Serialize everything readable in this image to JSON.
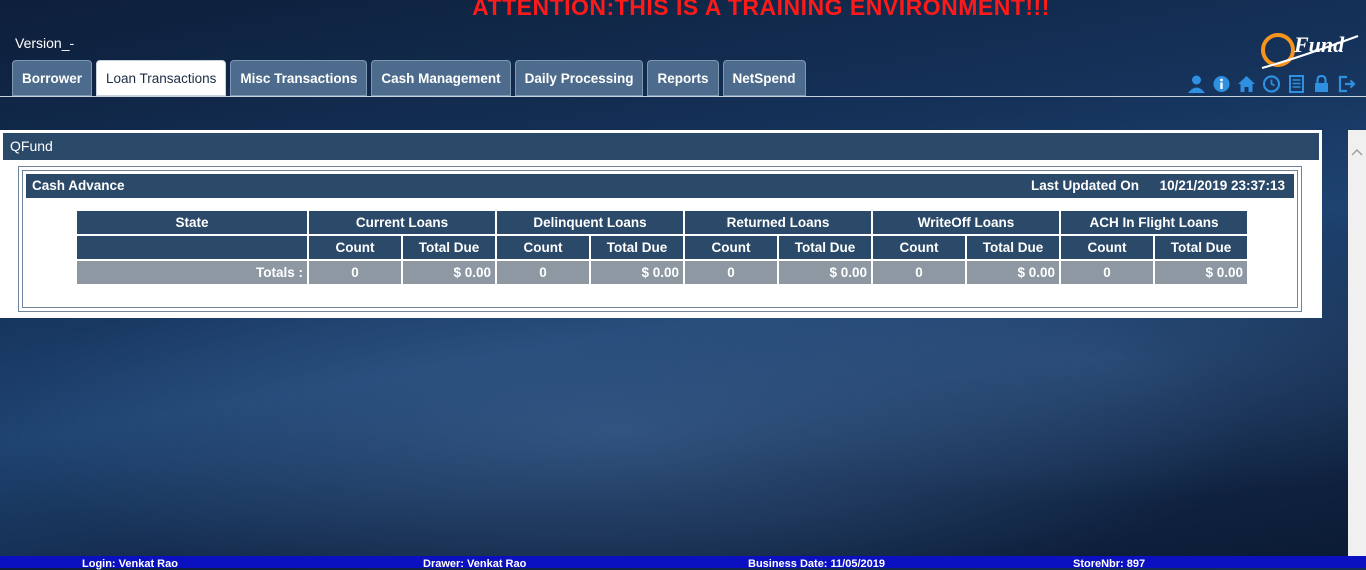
{
  "banner": "ATTENTION:THIS IS A TRAINING ENVIRONMENT!!!",
  "version": "Version_-",
  "logo": {
    "text": "Fund",
    "icon": "qfund-logo"
  },
  "colors": {
    "banner": "#ff1a1a",
    "header": "#2b4a69",
    "tab": "#4d6c8d",
    "footer": "#0b10c0"
  },
  "tabs": [
    {
      "label": "Borrower",
      "active": false
    },
    {
      "label": "Loan Transactions",
      "active": true
    },
    {
      "label": "Misc Transactions",
      "active": false
    },
    {
      "label": "Cash Management",
      "active": false
    },
    {
      "label": "Daily Processing",
      "active": false
    },
    {
      "label": "Reports",
      "active": false
    },
    {
      "label": "NetSpend",
      "active": false
    }
  ],
  "toolbar_icons": [
    "user-icon",
    "info-icon",
    "home-icon",
    "clock-icon",
    "calculator-icon",
    "lock-icon",
    "logout-icon"
  ],
  "panel": {
    "title": "QFund",
    "section_title": "Cash Advance",
    "last_updated_label": "Last Updated On",
    "last_updated_value": "10/21/2019 23:37:13",
    "table": {
      "state_header": "State",
      "groups": [
        "Current Loans",
        "Delinquent Loans",
        "Returned Loans",
        "WriteOff Loans",
        "ACH In Flight Loans"
      ],
      "sub_headers": [
        "Count",
        "Total Due"
      ],
      "totals_label": "Totals :",
      "totals": [
        {
          "count": "0",
          "due": "$ 0.00"
        },
        {
          "count": "0",
          "due": "$ 0.00"
        },
        {
          "count": "0",
          "due": "$ 0.00"
        },
        {
          "count": "0",
          "due": "$ 0.00"
        },
        {
          "count": "0",
          "due": "$ 0.00"
        }
      ]
    }
  },
  "footer": {
    "login": "Login: Venkat Rao",
    "drawer": "Drawer: Venkat Rao",
    "business_date": "Business Date: 11/05/2019",
    "store": "StoreNbr: 897"
  }
}
